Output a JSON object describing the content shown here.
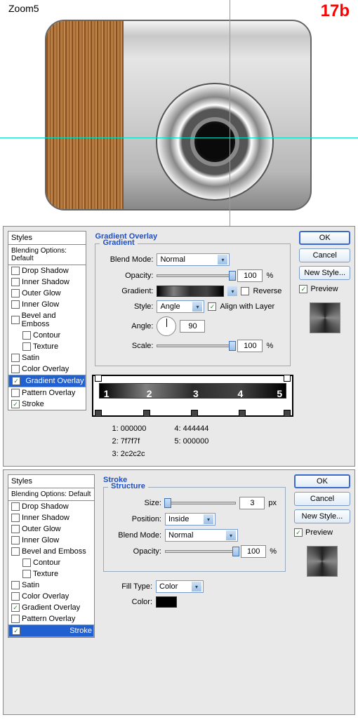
{
  "top": {
    "zoom": "Zoom5",
    "step": "17b"
  },
  "styles": [
    {
      "label": "Drop Shadow",
      "checked": false
    },
    {
      "label": "Inner Shadow",
      "checked": false
    },
    {
      "label": "Outer Glow",
      "checked": false
    },
    {
      "label": "Inner Glow",
      "checked": false
    },
    {
      "label": "Bevel and Emboss",
      "checked": false
    },
    {
      "label": "Contour",
      "checked": false,
      "indent": true
    },
    {
      "label": "Texture",
      "checked": false,
      "indent": true
    },
    {
      "label": "Satin",
      "checked": false
    },
    {
      "label": "Color Overlay",
      "checked": false
    },
    {
      "label": "Gradient Overlay",
      "checked": true
    },
    {
      "label": "Pattern Overlay",
      "checked": false
    },
    {
      "label": "Stroke",
      "checked": true
    }
  ],
  "sidebar": {
    "header": "Styles",
    "sub": "Blending Options: Default"
  },
  "panel1": {
    "selected": "Gradient Overlay",
    "title": "Gradient Overlay",
    "gradient": {
      "legend": "Gradient",
      "blend_label": "Blend Mode:",
      "blend_value": "Normal",
      "opacity_label": "Opacity:",
      "opacity_value": "100",
      "opacity_unit": "%",
      "gradient_label": "Gradient:",
      "reverse_label": "Reverse",
      "style_label": "Style:",
      "style_value": "Angle",
      "align_label": "Align with Layer",
      "angle_label": "Angle:",
      "angle_value": "90",
      "scale_label": "Scale:",
      "scale_value": "100",
      "scale_unit": "%"
    },
    "stops": {
      "n1": "1",
      "n2": "2",
      "n3": "3",
      "n4": "4",
      "n5": "5",
      "l1a": "1: 000000",
      "l2a": "2: 7f7f7f",
      "l3a": "3: 2c2c2c",
      "l1b": "4: 444444",
      "l2b": "5: 000000"
    }
  },
  "panel2": {
    "selected": "Stroke",
    "title": "Stroke",
    "legend": "Structure",
    "size_label": "Size:",
    "size_value": "3",
    "size_unit": "px",
    "position_label": "Position:",
    "position_value": "Inside",
    "blend_label": "Blend Mode:",
    "blend_value": "Normal",
    "opacity_label": "Opacity:",
    "opacity_value": "100",
    "opacity_unit": "%",
    "fill_label": "Fill Type:",
    "fill_value": "Color",
    "color_label": "Color:"
  },
  "buttons": {
    "ok": "OK",
    "cancel": "Cancel",
    "new": "New Style...",
    "preview": "Preview"
  }
}
